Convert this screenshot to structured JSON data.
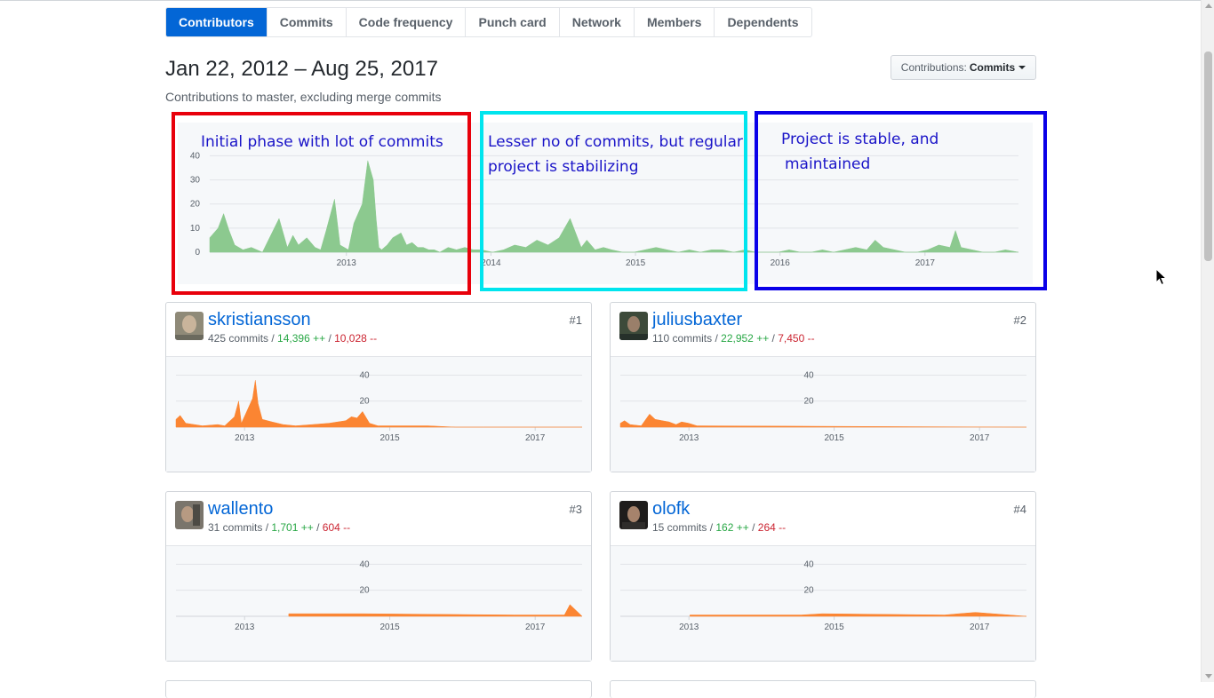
{
  "tabs": [
    {
      "label": "Contributors",
      "selected": true
    },
    {
      "label": "Commits",
      "selected": false
    },
    {
      "label": "Code frequency",
      "selected": false
    },
    {
      "label": "Punch card",
      "selected": false
    },
    {
      "label": "Network",
      "selected": false
    },
    {
      "label": "Members",
      "selected": false
    },
    {
      "label": "Dependents",
      "selected": false
    }
  ],
  "header": {
    "date_range": "Jan 22, 2012 – Aug 25, 2017",
    "subtitle": "Contributions to master, excluding merge commits",
    "select_prefix": "Contributions:",
    "select_value": "Commits"
  },
  "annotations": [
    {
      "text": "Initial phase with lot of commits",
      "color": "#e8000b"
    },
    {
      "text": "Lesser no of commits, but regular",
      "text2": "project is stabilizing",
      "color": "#00e5ee"
    },
    {
      "text": "Project is stable, and",
      "text2": "maintained",
      "color": "#0a00e8"
    }
  ],
  "colors": {
    "main_area": "#8cc98f",
    "user_area": "#fb8532",
    "accent": "#0366d6"
  },
  "chart_data": [
    {
      "type": "area",
      "title": "",
      "xlabel": "",
      "ylabel": "",
      "y_ticks": [
        0,
        10,
        20,
        30,
        40
      ],
      "x_ticks": [
        "2013",
        "2014",
        "2015",
        "2016",
        "2017"
      ],
      "ylim": [
        0,
        42
      ],
      "xlim": [
        "2012-01-22",
        "2017-08-25"
      ],
      "series": [
        {
          "x": [
            "2012-01-22",
            "2012-02-12",
            "2012-02-26",
            "2012-03-11",
            "2012-03-25",
            "2012-04-15",
            "2012-05-06",
            "2012-06-03",
            "2012-07-15",
            "2012-08-05",
            "2012-08-19",
            "2012-09-02",
            "2012-09-23",
            "2012-10-14",
            "2012-10-28",
            "2012-11-11",
            "2012-12-02",
            "2012-12-16",
            "2013-01-06",
            "2013-01-20",
            "2013-02-10",
            "2013-02-24",
            "2013-03-10",
            "2013-03-17",
            "2013-03-24",
            "2013-03-31",
            "2013-04-14",
            "2013-04-28",
            "2013-05-19",
            "2013-06-02",
            "2013-06-16",
            "2013-06-30",
            "2013-07-14",
            "2013-07-28",
            "2013-08-11",
            "2013-08-25",
            "2013-09-15",
            "2013-10-06",
            "2013-10-27",
            "2013-11-17",
            "2013-12-08",
            "2014-01-05",
            "2014-02-02",
            "2014-03-02",
            "2014-03-30",
            "2014-04-27",
            "2014-05-25",
            "2014-06-22",
            "2014-07-20",
            "2014-08-17",
            "2014-08-31",
            "2014-09-21",
            "2014-10-12",
            "2014-11-02",
            "2014-11-30",
            "2014-12-28",
            "2015-01-25",
            "2015-02-22",
            "2015-03-22",
            "2015-04-19",
            "2015-05-17",
            "2015-06-14",
            "2015-07-12",
            "2015-08-09",
            "2015-09-06",
            "2015-10-04",
            "2015-11-01",
            "2015-11-29",
            "2015-12-27",
            "2016-01-24",
            "2016-02-21",
            "2016-03-20",
            "2016-04-17",
            "2016-05-15",
            "2016-06-12",
            "2016-07-10",
            "2016-08-07",
            "2016-08-28",
            "2016-09-18",
            "2016-10-16",
            "2016-11-13",
            "2016-12-11",
            "2017-01-08",
            "2017-02-05",
            "2017-03-05",
            "2017-03-19",
            "2017-04-02",
            "2017-04-30",
            "2017-05-28",
            "2017-06-25",
            "2017-07-23",
            "2017-08-25"
          ],
          "values": [
            6,
            10,
            16,
            9,
            3,
            1,
            2,
            0,
            14,
            2,
            7,
            3,
            6,
            2,
            1,
            9,
            22,
            3,
            1,
            12,
            20,
            38,
            30,
            14,
            2,
            1,
            3,
            6,
            8,
            3,
            4,
            2,
            2,
            1,
            1,
            0,
            2,
            1,
            2,
            1,
            1,
            0,
            1,
            3,
            2,
            5,
            3,
            6,
            14,
            2,
            5,
            1,
            2,
            1,
            0,
            0,
            1,
            2,
            1,
            0,
            1,
            0,
            1,
            1,
            0,
            1,
            0,
            0,
            0,
            1,
            0,
            0,
            1,
            0,
            1,
            2,
            1,
            5,
            2,
            1,
            0,
            0,
            1,
            3,
            2,
            9,
            2,
            1,
            0,
            0,
            1,
            0
          ]
        }
      ]
    },
    {
      "type": "area",
      "title": "skristiansson",
      "y_ticks": [
        20,
        40
      ],
      "x_ticks": [
        "2013",
        "2015",
        "2017"
      ],
      "ylim": [
        0,
        45
      ],
      "series": [
        {
          "x": [
            "2012-01-22",
            "2012-02-12",
            "2012-03-11",
            "2012-06-03",
            "2012-08-19",
            "2012-09-23",
            "2012-11-11",
            "2012-12-02",
            "2012-12-16",
            "2013-01-06",
            "2013-02-10",
            "2013-02-24",
            "2013-03-10",
            "2013-03-31",
            "2013-05-19",
            "2013-07-14",
            "2013-09-15",
            "2013-12-08",
            "2014-03-02",
            "2014-05-25",
            "2014-06-22",
            "2014-07-20",
            "2014-08-17",
            "2014-09-21",
            "2014-11-02",
            "2015-03-22",
            "2015-07-12",
            "2015-11-29",
            "2016-04-17",
            "2017-08-25"
          ],
          "values": [
            6,
            9,
            3,
            1,
            2,
            1,
            8,
            20,
            3,
            10,
            22,
            36,
            18,
            6,
            4,
            2,
            1,
            2,
            3,
            5,
            8,
            7,
            12,
            3,
            1,
            1,
            1,
            0,
            0,
            0
          ]
        }
      ]
    },
    {
      "type": "area",
      "title": "juliusbaxter",
      "y_ticks": [
        20,
        40
      ],
      "x_ticks": [
        "2013",
        "2015",
        "2017"
      ],
      "ylim": [
        0,
        45
      ],
      "series": [
        {
          "x": [
            "2012-01-22",
            "2012-02-12",
            "2012-03-11",
            "2012-05-06",
            "2012-06-17",
            "2012-07-15",
            "2012-08-19",
            "2012-09-23",
            "2012-10-28",
            "2012-11-25",
            "2012-12-30",
            "2013-02-10",
            "2017-08-25"
          ],
          "values": [
            3,
            5,
            2,
            1,
            10,
            6,
            5,
            4,
            2,
            4,
            3,
            1,
            0
          ]
        }
      ]
    },
    {
      "type": "area",
      "title": "wallento",
      "y_ticks": [
        20,
        40
      ],
      "x_ticks": [
        "2013",
        "2015",
        "2017"
      ],
      "ylim": [
        0,
        45
      ],
      "series": [
        {
          "x": [
            "2013-08-11",
            "2013-10-27",
            "2014-02-02",
            "2014-04-27",
            "2014-08-17",
            "2016-09-18",
            "2017-05-28",
            "2017-06-25",
            "2017-08-25"
          ],
          "values": [
            2,
            2,
            2,
            2,
            2,
            1,
            1,
            9,
            0
          ]
        }
      ]
    },
    {
      "type": "area",
      "title": "olofk",
      "y_ticks": [
        20,
        40
      ],
      "x_ticks": [
        "2013",
        "2015",
        "2017"
      ],
      "ylim": [
        0,
        45
      ],
      "series": [
        {
          "x": [
            "2013-01-06",
            "2014-07-20",
            "2014-11-02",
            "2016-07-10",
            "2016-09-18",
            "2016-12-11",
            "2017-08-25"
          ],
          "values": [
            1,
            1,
            2,
            1,
            2,
            3,
            0
          ]
        }
      ]
    }
  ],
  "contributors": [
    {
      "name": "skristiansson",
      "commits": "425 commits",
      "additions": "14,396 ++",
      "deletions": "10,028 --",
      "rank": "#1"
    },
    {
      "name": "juliusbaxter",
      "commits": "110 commits",
      "additions": "22,952 ++",
      "deletions": "7,450 --",
      "rank": "#2"
    },
    {
      "name": "wallento",
      "commits": "31 commits",
      "additions": "1,701 ++",
      "deletions": "604 --",
      "rank": "#3"
    },
    {
      "name": "olofk",
      "commits": "15 commits",
      "additions": "162 ++",
      "deletions": "264 --",
      "rank": "#4"
    }
  ]
}
